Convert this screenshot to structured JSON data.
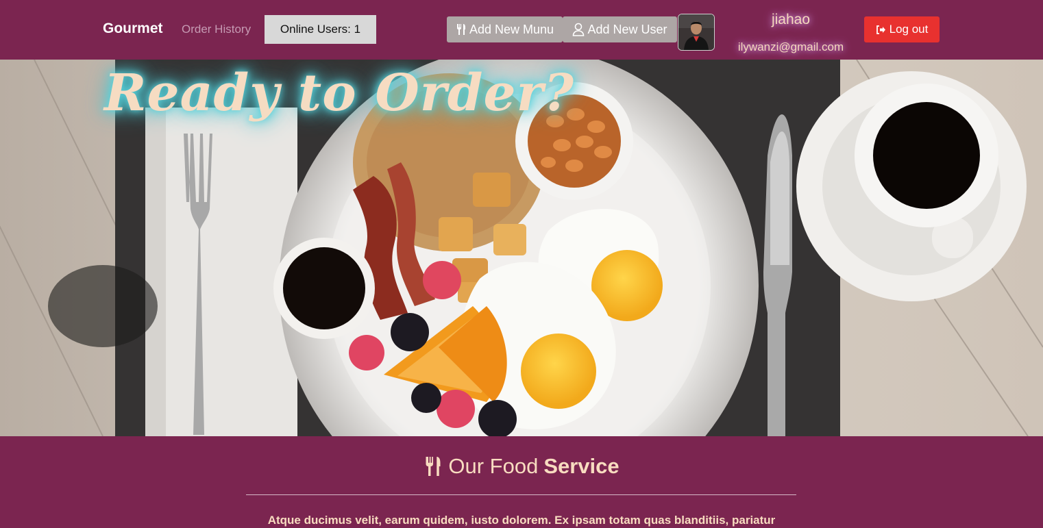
{
  "navbar": {
    "brand": "Gourmet",
    "order_history": "Order History",
    "online_users": "Online Users: 1",
    "add_menu": "Add New Munu",
    "add_user": "Add New User",
    "logout": "Log out",
    "user": {
      "name": "jiahao",
      "email": "ilywanzi@gmail.com"
    }
  },
  "hero": {
    "title": "Ready to Order?"
  },
  "section": {
    "title_light": "Our Food",
    "title_bold": "Service",
    "text": "Atque ducimus velit, earum quidem, iusto dolorem. Ex ipsam totam quas blanditiis, pariatur"
  },
  "colors": {
    "primary": "#7b2550",
    "accent_text": "#f8dcc0",
    "logout": "#e8312f",
    "gray_button": "#ada6a5"
  },
  "icons": {
    "menu_button": "utensils-icon",
    "user_button": "user-icon",
    "logout_button": "sign-out-icon",
    "section_title": "utensils-icon"
  }
}
